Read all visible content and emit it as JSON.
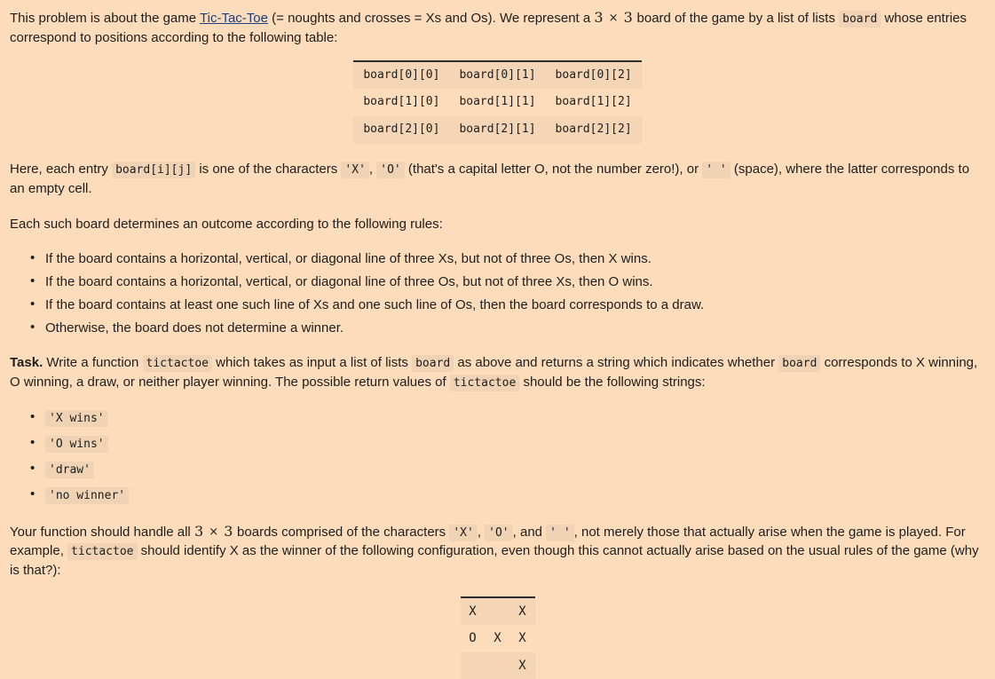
{
  "colors": {
    "page_background": "#fcdcba",
    "code_background": "#f0d3b4",
    "table_stripe": "#f4d6b6",
    "text": "#1d1d1d",
    "link": "#1a3f80",
    "table_border": "#2b2b2b"
  },
  "intro": {
    "part1": "This problem is about the game ",
    "link_text": "Tic-Tac-Toe",
    "part2": " (= noughts and crosses = Xs and Os). We represent a ",
    "dimensions": "3 × 3",
    "part3": " board of the game by a list of lists ",
    "code_board": "board",
    "part4": " whose entries correspond to positions according to the following table:"
  },
  "index_table": {
    "rows": [
      [
        "board[0][0]",
        "board[0][1]",
        "board[0][2]"
      ],
      [
        "board[1][0]",
        "board[1][1]",
        "board[1][2]"
      ],
      [
        "board[2][0]",
        "board[2][1]",
        "board[2][2]"
      ]
    ]
  },
  "entry_paragraph": {
    "part1": "Here, each entry ",
    "code_entry": "board[i][j]",
    "part2": " is one of the characters ",
    "code_x": "'X'",
    "comma1": ", ",
    "code_o": "'O'",
    "part3": " (that's a capital letter O, not the number zero!), or ",
    "code_space": "' '",
    "part4": " (space), where the latter corresponds to an empty cell."
  },
  "rules_intro": "Each such board determines an outcome according to the following rules:",
  "rules": [
    "If the board contains a horizontal, vertical, or diagonal line of three Xs, but not of three Os, then X wins.",
    "If the board contains a horizontal, vertical, or diagonal line of three Os, but not of three Xs, then O wins.",
    "If the board contains at least one such line of Xs and one such line of Os, then the board corresponds to a draw.",
    "Otherwise, the board does not determine a winner."
  ],
  "task": {
    "label": "Task.",
    "part1": " Write a function ",
    "code_fn": "tictactoe",
    "part2": " which takes as input a list of lists ",
    "code_board": "board",
    "part3": " as above and returns a string which indicates whether ",
    "code_board2": "board",
    "part4": " corresponds to X winning, O winning, a draw, or neither player winning. The possible return values of ",
    "code_fn2": "tictactoe",
    "part5": " should be the following strings:"
  },
  "return_values": [
    "'X wins'",
    "'O wins'",
    "'draw'",
    "'no winner'"
  ],
  "closing": {
    "part1": "Your function should handle all ",
    "dimensions": "3 × 3",
    "part2": " boards comprised of the characters ",
    "code_x": "'X'",
    "comma1": ", ",
    "code_o": "'O'",
    "part3": ", and ",
    "code_space": "' '",
    "part4": ", not merely those that actually arise when the game is played. For example, ",
    "code_fn": "tictactoe",
    "part5": " should identify X as the winner of the following configuration, even though this cannot actually arise based on the usual rules of the game (why is that?):"
  },
  "example_board": {
    "rows": [
      [
        "X",
        " ",
        "X"
      ],
      [
        "O",
        "X",
        "X"
      ],
      [
        " ",
        " ",
        "X"
      ]
    ]
  }
}
